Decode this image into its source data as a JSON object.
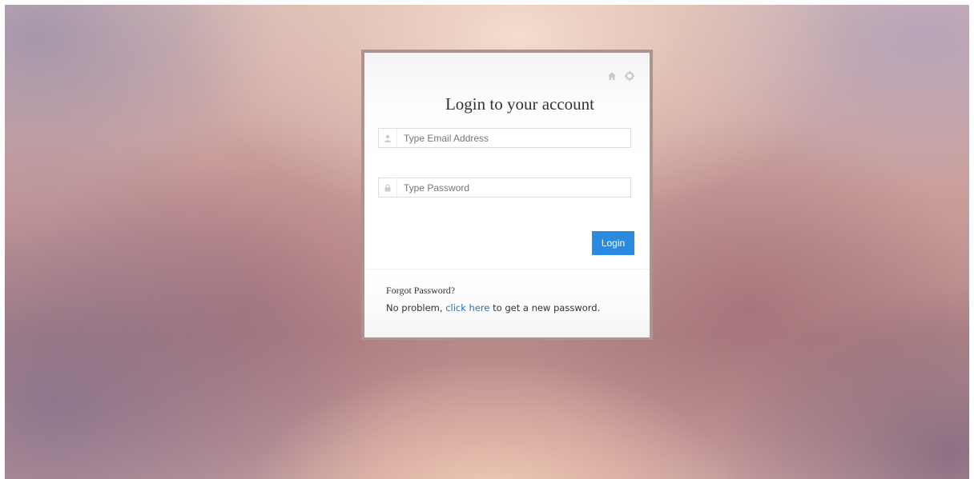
{
  "login": {
    "title": "Login to your account",
    "email_placeholder": "Type Email Address",
    "password_placeholder": "Type Password",
    "login_label": "Login"
  },
  "toolbar": {
    "icons": [
      "home-icon",
      "gear-icon"
    ]
  },
  "forgot": {
    "heading": "Forgot Password?",
    "text_before": "No problem, ",
    "link_text": "click here",
    "text_after": " to get a new password."
  },
  "colors": {
    "accent": "#2a8ae0",
    "link": "#2a6ebb",
    "box_border": "#ad958f"
  }
}
